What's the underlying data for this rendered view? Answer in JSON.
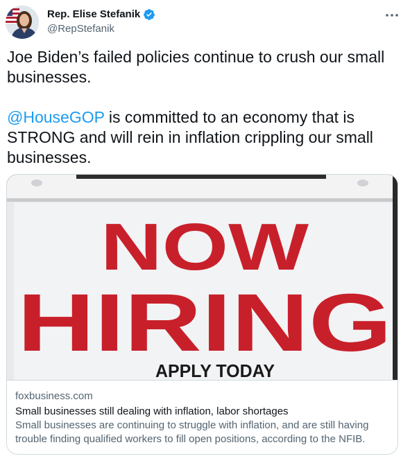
{
  "author": {
    "display_name": "Rep. Elise Stefanik",
    "handle": "@RepStefanik",
    "verified": true,
    "avatar_icon": "profile-photo"
  },
  "tweet": {
    "paragraph1": "Joe Biden’s failed policies continue to crush our small businesses.",
    "mention": "@HouseGOP",
    "paragraph2_rest": " is committed to an economy that is STRONG and will rein in inflation crippling our small businesses."
  },
  "card": {
    "image": {
      "sign_line1": "NOW",
      "sign_line2": "HIRING",
      "sign_line3": "APPLY TODAY"
    },
    "domain": "foxbusiness.com",
    "title": "Small businesses still dealing with inflation, labor shortages",
    "description": "Small businesses are continuing to struggle with inflation, and are still having trouble finding qualified workers to fill open positions, according to the NFIB."
  },
  "colors": {
    "link_blue": "#1d9bf0",
    "secondary_text": "#536471",
    "sign_red": "#c8202a"
  },
  "icons": {
    "more": "more-dots-icon",
    "verified": "verified-badge-icon"
  }
}
